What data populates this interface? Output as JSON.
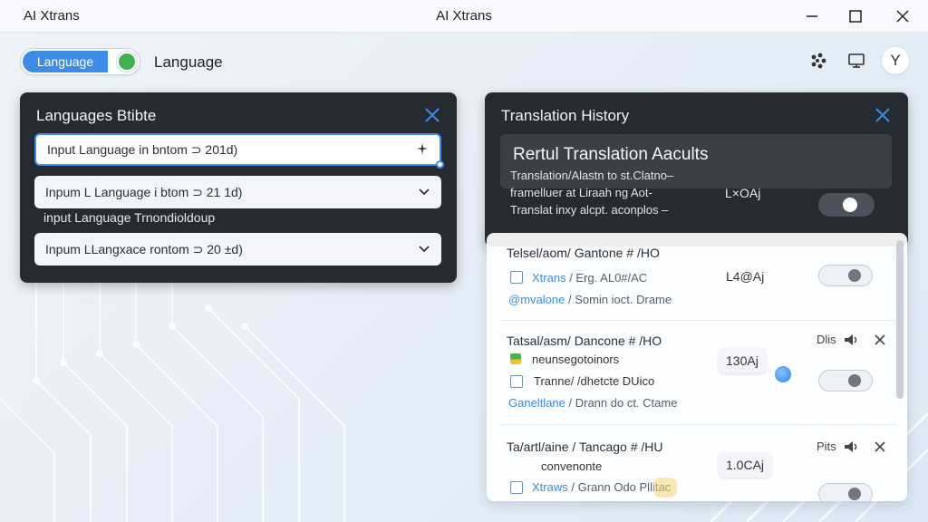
{
  "window": {
    "app_name": "AI Xtrans",
    "title": "AI Xtrans"
  },
  "top": {
    "toggle_label": "Language",
    "label": "Language",
    "avatar_letter": "Y"
  },
  "languages_panel": {
    "title": "Languages Btibte",
    "fields": [
      {
        "value": "Input Language in bntom ⊃ 201d)"
      },
      {
        "value": "Inpum L Language i btom ⊃ 21 1d)"
      },
      {
        "value": "Inpum LLangxace rontom ⊃ 20 ±d)"
      }
    ],
    "helper": "input Language Trnondioldoup"
  },
  "history_panel": {
    "title": "Translation History",
    "heading": "Rertul Translation Aacults",
    "lines": [
      "Translation/Alastn to st.Clatno–",
      "framelluer at Liraah ng Aot-",
      "Translat inxy alcpt. aconplos –"
    ],
    "badge": "L×OAj"
  },
  "history_items": [
    {
      "title": "Telsel/aom/ Gantone # /HO",
      "line1_link": "Xtrans",
      "line1_text": "/ Erg. AL0#/AC",
      "line2_link": "@mvalone",
      "line2_text": "/ Somin ioct. Drame",
      "badge": "L4@Aj"
    },
    {
      "title": "Tatsal/asm/ Dancone # /HO",
      "controls_label": "Dlis",
      "line1_text": "neunsegotoinors",
      "line2_text": "Tranne/ /dhetcte DUico",
      "line3_link": "Ganeltlane",
      "line3_text": "/ Drann do ct. Ctame",
      "badge": "130Aj"
    },
    {
      "title": "Ta/artl/aine / Tancago # /HU",
      "controls_label": "Pits",
      "line1_text": "convenonte",
      "line2_link": "Xtraws",
      "line2_text": "/ Grann Odo Pllitac",
      "badge": "1.0CAj"
    }
  ],
  "colors": {
    "accent": "#3d8ce6",
    "panel_dark": "#262b31",
    "toggle_green": "#3fb24f"
  }
}
